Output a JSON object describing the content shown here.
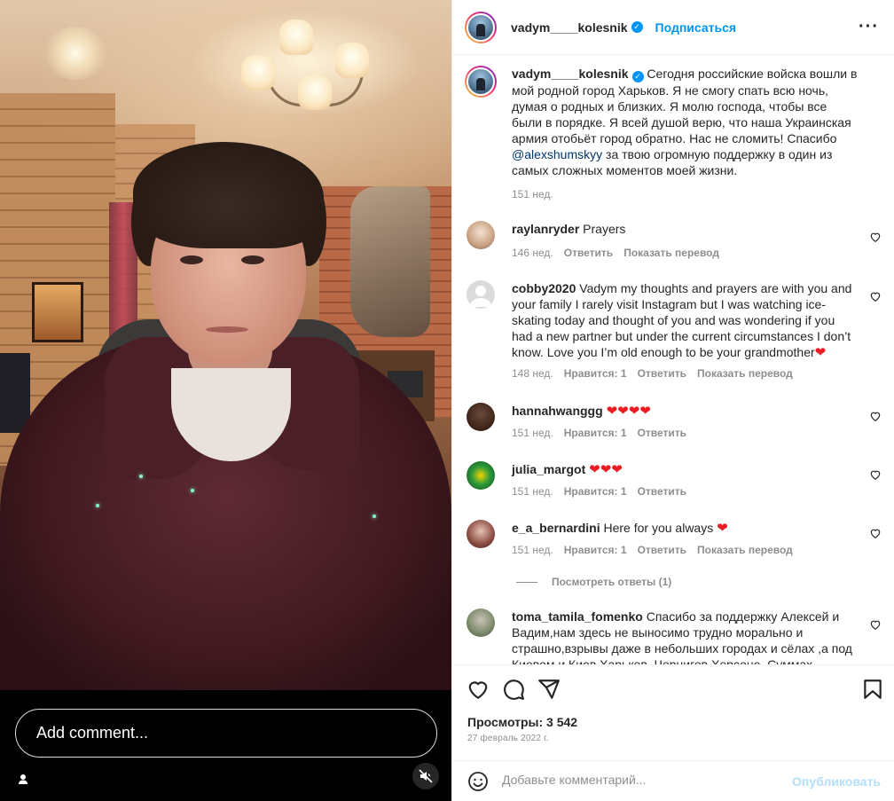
{
  "video": {
    "comment_placeholder": "Add comment..."
  },
  "post": {
    "username": "vadym____kolesnik",
    "follow_label": "Подписаться",
    "caption": "Сегодня российские войска вошли в мой родной город Харьков. Я не смогу спать всю ночь, думая о родных и близких. Я молю господа, чтобы все были в порядке. Я всей душой верю, что наша Украинская армия отобьёт город обратно. Нас не сломить! Спасибо",
    "caption_mention": "@alexshumskyy",
    "caption_end": "за твою огромную поддержку в один из самых сложных моментов моей жизни.",
    "caption_age": "151 нед.",
    "views": "Просмотры: 3 542",
    "date": "27 февраль 2022 г.",
    "view_replies": "Посмотреть ответы (1)"
  },
  "comments": [
    {
      "user": "raylanryder",
      "text": "Prayers",
      "age": "146 нед.",
      "likes": "",
      "reply": "Ответить",
      "translate": "Показать перевод"
    },
    {
      "user": "cobby2020",
      "text": "Vadym my thoughts and prayers are with you and your family I rarely visit Instagram but I was watching ice-skating today and thought of you and was wondering if you had a new partner but under the current circumstances I don’t know. Love you I’m old enough to be your grandmother",
      "emoji": "❤",
      "age": "148 нед.",
      "likes": "Нравится: 1",
      "reply": "Ответить",
      "translate": "Показать перевод"
    },
    {
      "user": "hannahwanggg",
      "text": "",
      "emoji": "❤❤❤❤",
      "age": "151 нед.",
      "likes": "Нравится: 1",
      "reply": "Ответить"
    },
    {
      "user": "julia_margot",
      "text": "",
      "emoji": "❤❤❤",
      "age": "151 нед.",
      "likes": "Нравится: 1",
      "reply": "Ответить"
    },
    {
      "user": "e_a_bernardini",
      "text": "Here for you always",
      "emoji": "❤",
      "age": "151 нед.",
      "likes": "Нравится: 1",
      "reply": "Ответить",
      "translate": "Показать перевод"
    },
    {
      "user": "toma_tamila_fomenko",
      "text": "Спасибо за поддержку Алексей и Вадим,нам здесь не выносимо трудно морально и страшно,взрывы даже в небольших городах и сёлах ,а под Киевом и Киев Харьков, Чернигов Херсоне, Суммах"
    }
  ],
  "footer": {
    "placeholder": "Добавьте комментарий...",
    "post_label": "Опубликовать"
  },
  "colors": {
    "accent": "#0095f6",
    "heart": "#ed1c24",
    "muted": "#8e8e8e"
  }
}
